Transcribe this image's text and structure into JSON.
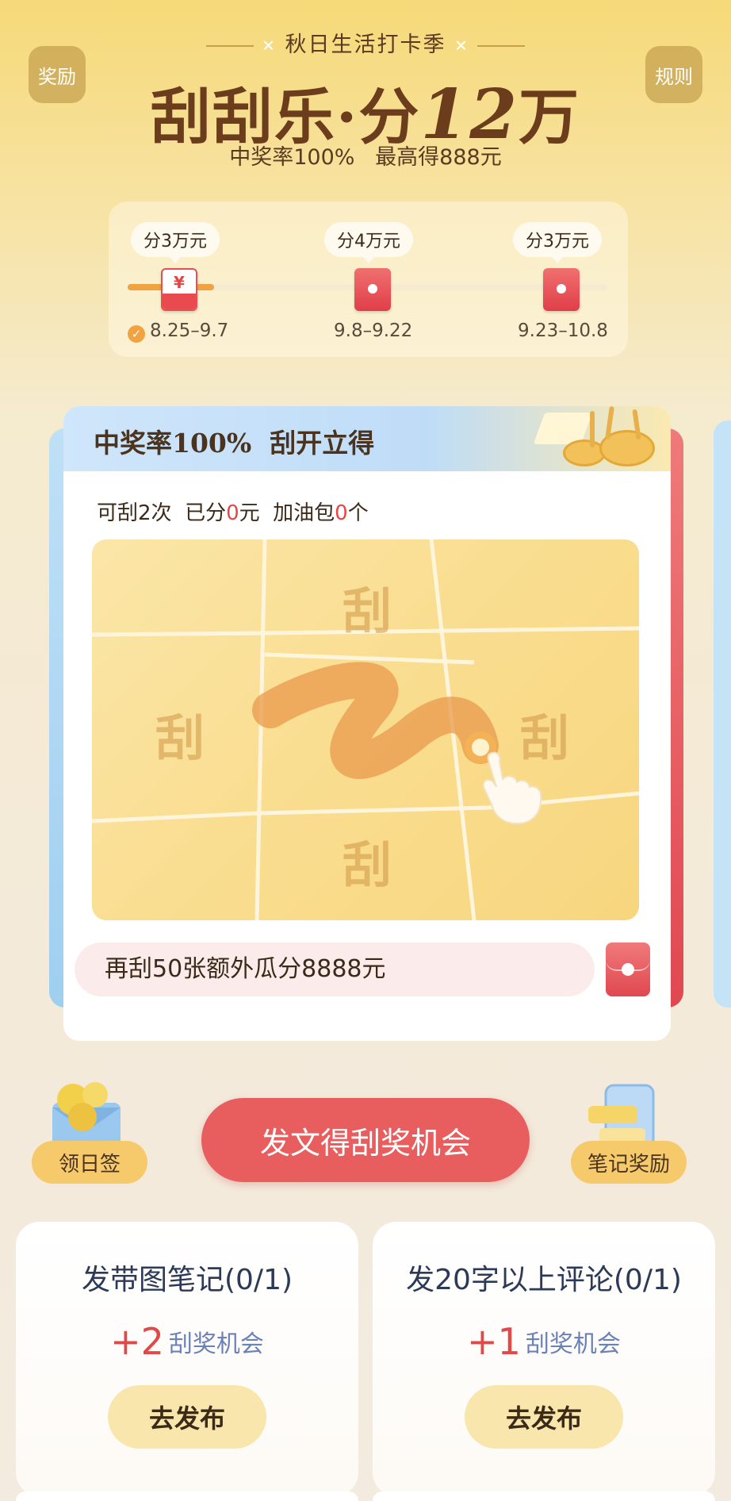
{
  "header": {
    "left_button": "奖励",
    "right_button": "规则",
    "season_label": "秋日生活打卡季",
    "title_main": "刮刮乐·分",
    "title_number": "12",
    "title_unit": "万",
    "subtitle": "中奖率100%   最高得888元"
  },
  "timeline": {
    "progress_fraction": 0.18,
    "stages": [
      {
        "label": "分3万元",
        "dates": "8.25–9.7",
        "state": "current"
      },
      {
        "label": "分4万元",
        "dates": "9.8–9.22",
        "state": "locked"
      },
      {
        "label": "分3万元",
        "dates": "9.23–10.8",
        "state": "locked"
      }
    ]
  },
  "scratch_card": {
    "heading": "中奖率100%  刮开立得",
    "stats_prefix": "可刮2次  已分",
    "stats_amount": "0",
    "stats_mid": "元  加油包",
    "stats_pack": "0",
    "stats_suffix": "个",
    "tile_char": "刮",
    "promo_text": "再刮50张额外瓜分8888元"
  },
  "actions": {
    "daily_sign": "领日签",
    "main_button": "发文得刮奖机会",
    "note_reward": "笔记奖励"
  },
  "tasks": [
    {
      "title": "发带图笔记(0/1)",
      "plus": "+2",
      "reward_label": "刮奖机会",
      "button": "去发布"
    },
    {
      "title": "发20字以上评论(0/1)",
      "plus": "+1",
      "reward_label": "刮奖机会",
      "button": "去发布"
    }
  ],
  "colors": {
    "accent_red": "#e85e5e",
    "accent_orange": "#f2a341",
    "brand_brown": "#6b3d1c"
  }
}
